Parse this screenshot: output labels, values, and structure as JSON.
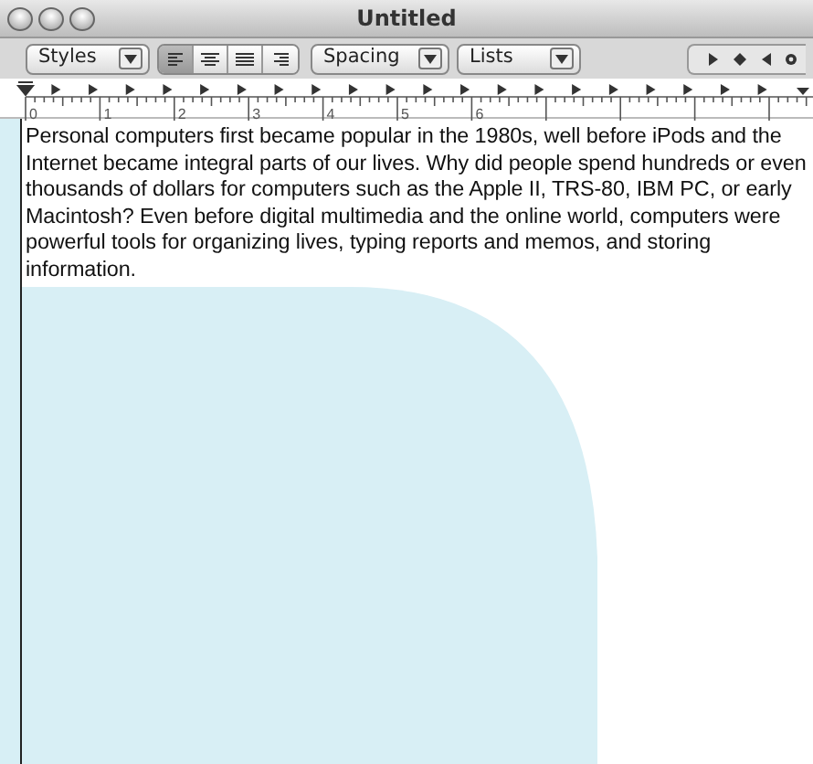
{
  "window": {
    "title": "Untitled"
  },
  "toolbar": {
    "styles": {
      "label": "Styles"
    },
    "alignment": [
      {
        "kind": "left",
        "selected": true
      },
      {
        "kind": "center",
        "selected": false
      },
      {
        "kind": "justify",
        "selected": false
      },
      {
        "kind": "right",
        "selected": false
      }
    ],
    "spacing": {
      "label": "Spacing"
    },
    "lists": {
      "label": "Lists"
    },
    "tab_stops": [
      {
        "kind": "left"
      },
      {
        "kind": "center"
      },
      {
        "kind": "right"
      },
      {
        "kind": "decimal"
      }
    ]
  },
  "ruler": {
    "labels": [
      "0",
      "1",
      "2",
      "3",
      "4",
      "5",
      "6"
    ]
  },
  "document": {
    "text": "Personal computers first became popular in the 1980s, well before iPods and the Internet became integral parts of our lives. Why did people spend hundreds or even thousands of dollars for computers such as the Apple II, TRS-80, IBM PC, or early Macintosh? Even before digital multimedia and the online world, computers were powerful tools for organizing lives, typing reports and memos, and storing information."
  }
}
